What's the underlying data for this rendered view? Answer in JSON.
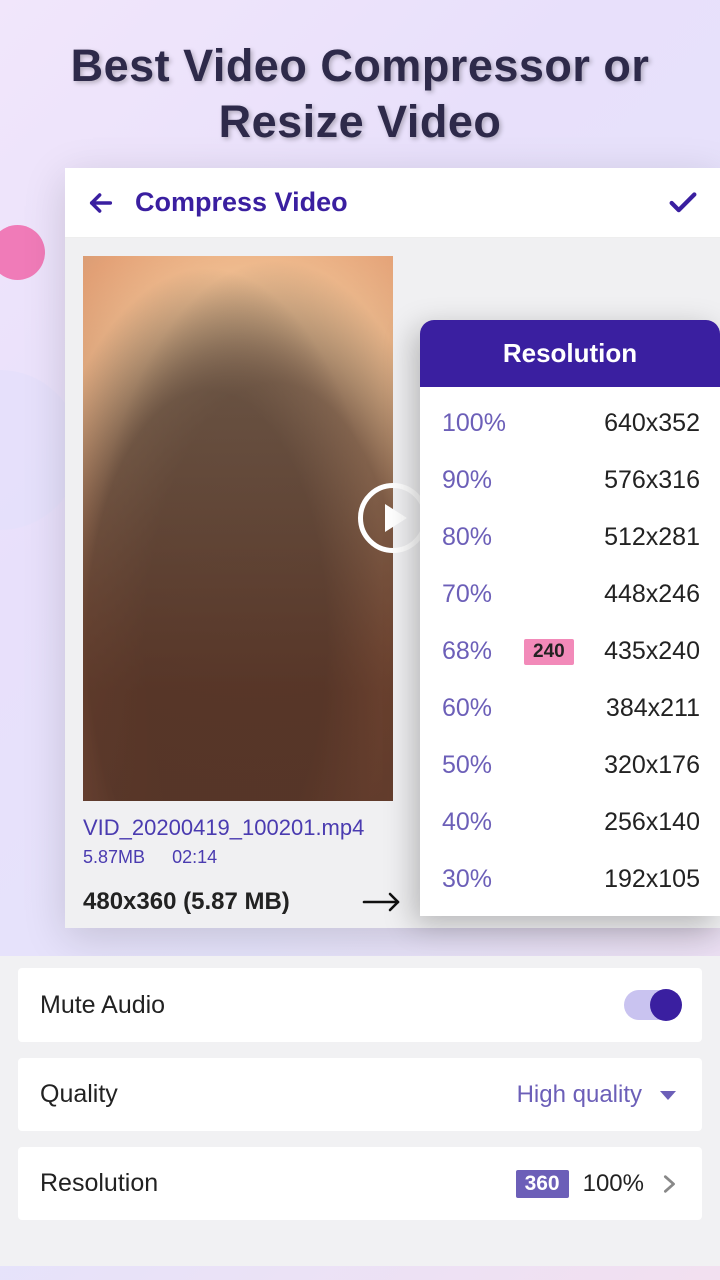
{
  "headline": "Best Video Compressor or Resize Video",
  "appbar": {
    "title": "Compress Video"
  },
  "video": {
    "filename": "VID_20200419_100201.mp4",
    "size": "5.87MB",
    "duration": "02:14",
    "current_resolution": "480x360 (5.87 MB)"
  },
  "popup": {
    "title": "Resolution",
    "badge": "240",
    "rows": [
      {
        "pct": "100%",
        "dims": "640x352"
      },
      {
        "pct": "90%",
        "dims": "576x316"
      },
      {
        "pct": "80%",
        "dims": "512x281"
      },
      {
        "pct": "70%",
        "dims": "448x246"
      },
      {
        "pct": "68%",
        "dims": "435x240",
        "badge": true
      },
      {
        "pct": "60%",
        "dims": "384x211"
      },
      {
        "pct": "50%",
        "dims": "320x176"
      },
      {
        "pct": "40%",
        "dims": "256x140"
      },
      {
        "pct": "30%",
        "dims": "192x105"
      }
    ]
  },
  "settings": {
    "mute_label": "Mute Audio",
    "quality_label": "Quality",
    "quality_value": "High quality",
    "resolution_label": "Resolution",
    "resolution_badge": "360",
    "resolution_pct": "100%"
  }
}
